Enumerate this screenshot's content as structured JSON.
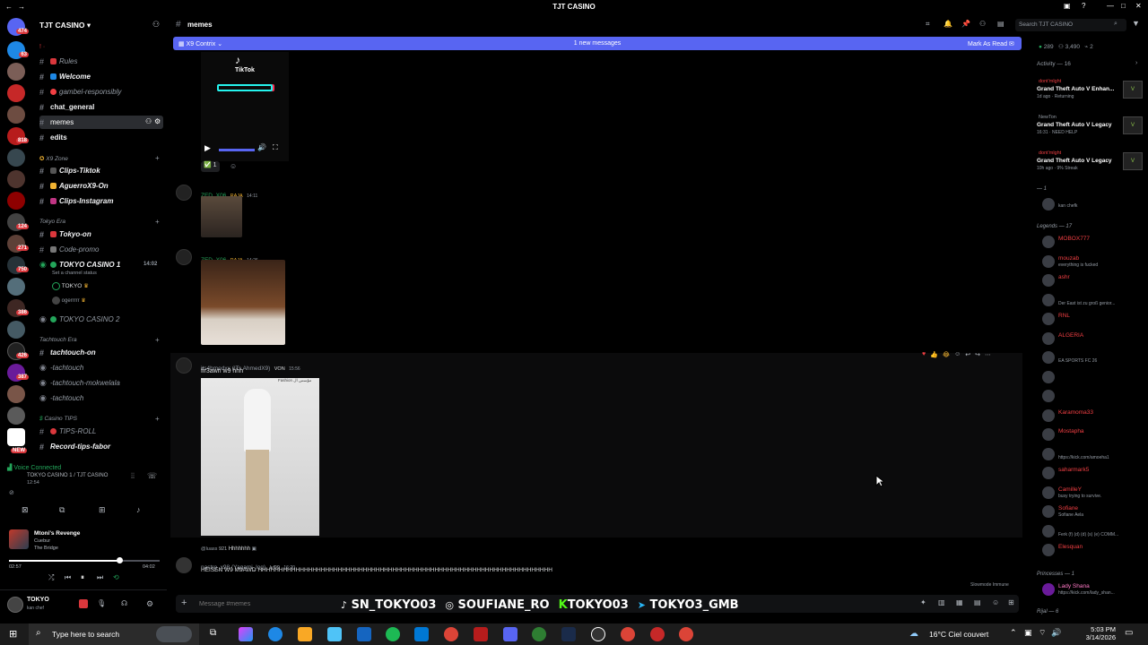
{
  "window": {
    "title": "TJT CASINO"
  },
  "server": {
    "name": "TJT CASINO"
  },
  "rail_badges": [
    "474",
    "63",
    "818",
    "124",
    "271",
    "750",
    "386",
    "426",
    "387",
    "NEW"
  ],
  "channels": {
    "rules": "Rules",
    "welcome": "Welcome",
    "gambel": "gambel-responsibly",
    "chat_general": "chat_general",
    "memes": "memes",
    "edits": "edits",
    "cat_x9": "X9 Zone",
    "clips_tiktok": "Clips-Tiktok",
    "aguerro": "AguerroX9-On",
    "clips_instagram": "Clips-Instagram",
    "cat_tokyo": "Tokyo Era",
    "tokyo_on": "Tokyo-on",
    "code_promo": "Code-promo",
    "tokyo_casino1": "TOKYO CASINO 1",
    "tokyo_casino1_time": "14:02",
    "set_status": "Set a channel status",
    "vc_user1": "TOKYO",
    "vc_user2": "ogerrrrr",
    "tokyo_casino2": "TOKYO CASINO 2",
    "cat_tachtouch": "Tachtouch Era",
    "tachtouch_on": "tachtouch-on",
    "tachtouch": "-tachtouch",
    "tachtouch_mok": "-tachtouch-mokwelala",
    "tachtouch2": "-tachtouch",
    "cat_casino": "Casino TIPS",
    "tips_roll": "TIPS-ROLL",
    "record_tips": "Record-tips-fabor"
  },
  "voice": {
    "status": "Voice Connected",
    "channel": "TOKYO CASINO 1 / TJT CASINO",
    "time": "12:54",
    "activity_title": "Mtoni's Revenge",
    "activity_artist": "Cuebur",
    "activity_album": "The Bridge",
    "elapsed": "02:57",
    "total": "04:02",
    "progress": 0.73,
    "user": "TOKYO",
    "user_status": "kan chef"
  },
  "chat": {
    "channel": "memes",
    "new_bar_left": "X9 Contrix",
    "new_bar_center": "1 new messages",
    "new_bar_right": "Mark As Read",
    "tiktok_label": "TikTok",
    "reaction_count": "1",
    "msg1_author": "ZED_X06",
    "msg1_tag": "RAJA",
    "msg1_time": "14:11",
    "msg2_author": "ZED_X06",
    "msg2_tag": "RAJA",
    "msg2_time": "14:26",
    "msg3_author": "its4hmedxx (ITs AhmedX9)",
    "msg3_tag": "VON",
    "msg3_time": "15:56",
    "msg3_text": "fir3awn w9 hhh",
    "msg3_caption": "Fashion مؤسس ال",
    "reply_author": "@luass",
    "reply_tag": "921",
    "reply_text": "Hhhhhhh",
    "msg4_author": "nastro_x98 (Yagami_log)",
    "msg4_tag": "lvl99",
    "msg4_time": "16:20",
    "msg4_text": "HEISEN W9 M9AWD HHHHHHHHHHHHHHHHHHHHHHHHHHHHHHHHHHHHHHHHHHHHHHHHHHHHHHHHHHHHHHHHHHHHHH",
    "slowmode": "Slowmode Immune",
    "input_placeholder": "Message #memes",
    "socials": [
      "SN_TOKYO03",
      "SOUFIANE_RO",
      "TOKYO03",
      "TOKYO3_GMB"
    ]
  },
  "header": {
    "search_placeholder": "Search TJT CASINO"
  },
  "members": {
    "stats": [
      "289",
      "3,490",
      "2"
    ],
    "activity_title": "Activity — 16",
    "activities": [
      {
        "user": "dont'mlght",
        "game": "Grand Theft Auto V Enhan...",
        "sub": "1d ago · Returning"
      },
      {
        "user": "NewTon",
        "game": "Grand Theft Auto V Legacy",
        "sub": "16:31 · NEED HELP"
      },
      {
        "user": "dont'mlght",
        "game": "Grand Theft Auto V Legacy",
        "sub": "10h ago · 9% Streak"
      }
    ],
    "group1": "— 1",
    "m1_status": "kan chefk",
    "group_legends": "Legends — 17",
    "legends": [
      {
        "name": "MOBOX777",
        "status": ""
      },
      {
        "name": "mouzab",
        "status": "everything is fucked"
      },
      {
        "name": "ashr",
        "status": ""
      },
      {
        "name": "",
        "status": "Der East ist zu groß genior..."
      },
      {
        "name": "RNL",
        "status": ""
      },
      {
        "name": "ALGERIA",
        "status": ""
      },
      {
        "name": "",
        "status": "EA SPORTS FC 26"
      },
      {
        "name": "",
        "status": ""
      },
      {
        "name": "",
        "status": ""
      },
      {
        "name": "Karamoma33",
        "status": ""
      },
      {
        "name": "Mostapha",
        "status": ""
      },
      {
        "name": "",
        "status": "https://kick.com/amoeha1"
      },
      {
        "name": "saharmark5",
        "status": ""
      },
      {
        "name": "CamilleY",
        "status": "busy trying to survive."
      },
      {
        "name": "Sofiane",
        "status": "Sofiane Aela"
      },
      {
        "name": "",
        "status": "Ferk (f) (d) (d) (s) (e) COMM..."
      },
      {
        "name": "Elesquan",
        "status": ""
      }
    ],
    "group_princesses": "Princesses — 1",
    "princess": {
      "name": "Lady Shana",
      "status": "https://kick.com/lady_shan..."
    },
    "group_rijal": "Rijal — 6"
  },
  "taskbar": {
    "search": "Type here to search",
    "weather": "16°C  Ciel couvert",
    "time": "5:03 PM",
    "date": "3/14/2026"
  }
}
